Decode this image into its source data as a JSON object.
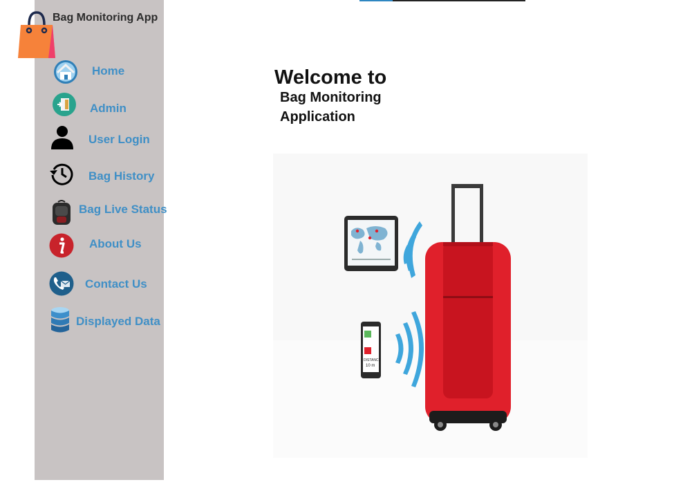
{
  "app": {
    "title": "Bag Monitoring App"
  },
  "sidebar": {
    "items": [
      {
        "label": "Home",
        "icon": "home-icon"
      },
      {
        "label": "Admin",
        "icon": "admin-icon"
      },
      {
        "label": "User Login",
        "icon": "user-icon"
      },
      {
        "label": "Bag History",
        "icon": "history-icon"
      },
      {
        "label": "Bag Live Status",
        "icon": "backpack-icon"
      },
      {
        "label": "About Us",
        "icon": "info-icon"
      },
      {
        "label": "Contact Us",
        "icon": "phone-mail-icon"
      },
      {
        "label": "Displayed Data",
        "icon": "database-icon"
      }
    ]
  },
  "main": {
    "heading": "Welcome to",
    "subheading_line1": "Bag Monitoring",
    "subheading_line2": "Application",
    "illustration": {
      "phone_distance_label": "DISTANCE",
      "phone_distance_value": "10 m"
    }
  },
  "colors": {
    "sidebar_bg": "#c8c3c3",
    "nav_text": "#3f8fc6",
    "suitcase_red": "#e0202b",
    "signal_blue": "#3fa6dc"
  }
}
